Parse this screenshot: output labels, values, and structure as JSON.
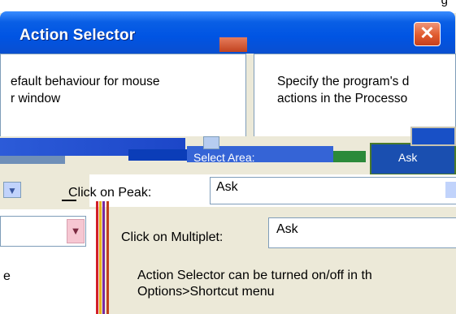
{
  "window": {
    "title": "Action Selector",
    "close_glyph": "✕",
    "top_right_fragment": "g"
  },
  "panels": {
    "left_text": "efault behaviour for mouse\nr window",
    "right_text": "Specify the program's d\nactions in the Processo"
  },
  "glitch": {
    "text_a": "Select Area:",
    "text_b": "Ask"
  },
  "peak": {
    "label": "Click on Peak:",
    "value": "Ask"
  },
  "left_fragment": "e",
  "multiplet": {
    "label": "Click on Multiplet:",
    "value": "Ask"
  },
  "info": "Action Selector can be turned on/off in th\nOptions>Shortcut menu",
  "colors": {
    "title_blue": "#0054e3",
    "close_red": "#e05a2e",
    "stripe_red": "#d21f2a",
    "stripe_yellow": "#e9b31c",
    "stripe_purple": "#7a2aa0"
  }
}
